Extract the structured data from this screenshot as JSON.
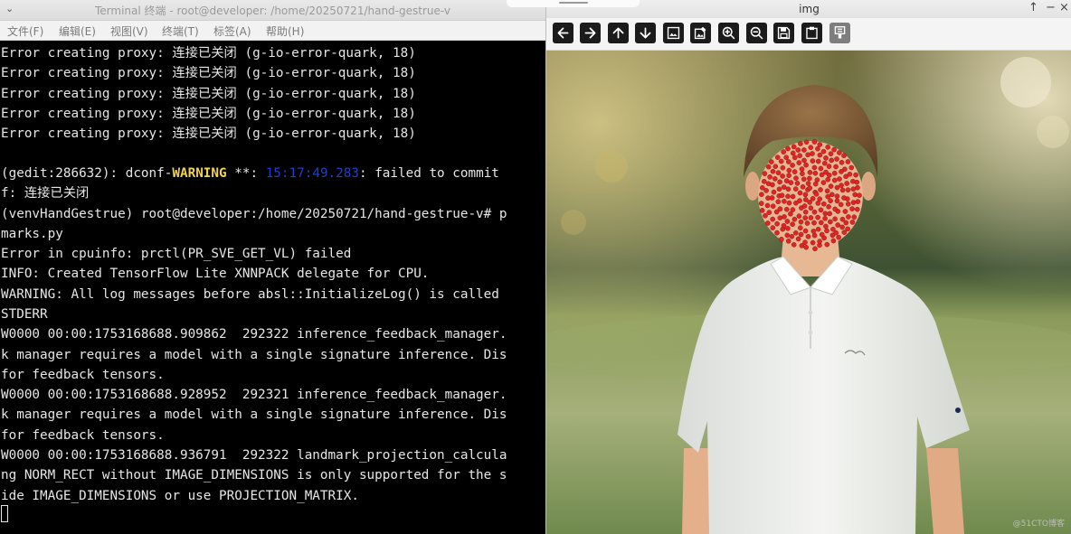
{
  "terminal": {
    "title": "Terminal 终端 - root@developer: /home/20250721/hand-gestrue-v",
    "menu": [
      "文件(F)",
      "编辑(E)",
      "视图(V)",
      "终端(T)",
      "标签(A)",
      "帮助(H)"
    ],
    "lines": [
      "Error creating proxy: 连接已关闭 (g-io-error-quark, 18)",
      "Error creating proxy: 连接已关闭 (g-io-error-quark, 18)",
      "Error creating proxy: 连接已关闭 (g-io-error-quark, 18)",
      "Error creating proxy: 连接已关闭 (g-io-error-quark, 18)",
      "Error creating proxy: 连接已关闭 (g-io-error-quark, 18)",
      "",
      "",
      "f: 连接已关闭",
      "(venvHandGestrue) root@developer:/home/20250721/hand-gestrue-v# p",
      "marks.py",
      "Error in cpuinfo: prctl(PR_SVE_GET_VL) failed",
      "INFO: Created TensorFlow Lite XNNPACK delegate for CPU.",
      "WARNING: All log messages before absl::InitializeLog() is called",
      "STDERR",
      "W0000 00:00:1753168688.909862  292322 inference_feedback_manager.",
      "k manager requires a model with a single signature inference. Dis",
      "for feedback tensors.",
      "W0000 00:00:1753168688.928952  292321 inference_feedback_manager.",
      "k manager requires a model with a single signature inference. Dis",
      "for feedback tensors.",
      "W0000 00:00:1753168688.936791  292322 landmark_projection_calcula",
      "ng NORM_RECT without IMAGE_DIMENSIONS is only supported for the s",
      "ide IMAGE_DIMENSIONS or use PROJECTION_MATRIX."
    ],
    "warning_line": {
      "prefix": "(gedit:286632): dconf-",
      "level": "WARNING",
      "mid": " **: ",
      "time": "15:17:49.283",
      "suffix": ": failed to commit"
    }
  },
  "viewer": {
    "title": "img",
    "buttons": {
      "pin": "↑",
      "minimize": "−",
      "close": "×"
    },
    "toolbar": [
      "back-icon",
      "forward-icon",
      "up-icon",
      "down-icon",
      "image-icon",
      "image-edit-icon",
      "zoom-in-icon",
      "zoom-out-icon",
      "save-icon",
      "clipboard-icon",
      "properties-icon"
    ],
    "watermark": "@51CTO博客",
    "colors": {
      "landmark": "#e02424"
    }
  }
}
